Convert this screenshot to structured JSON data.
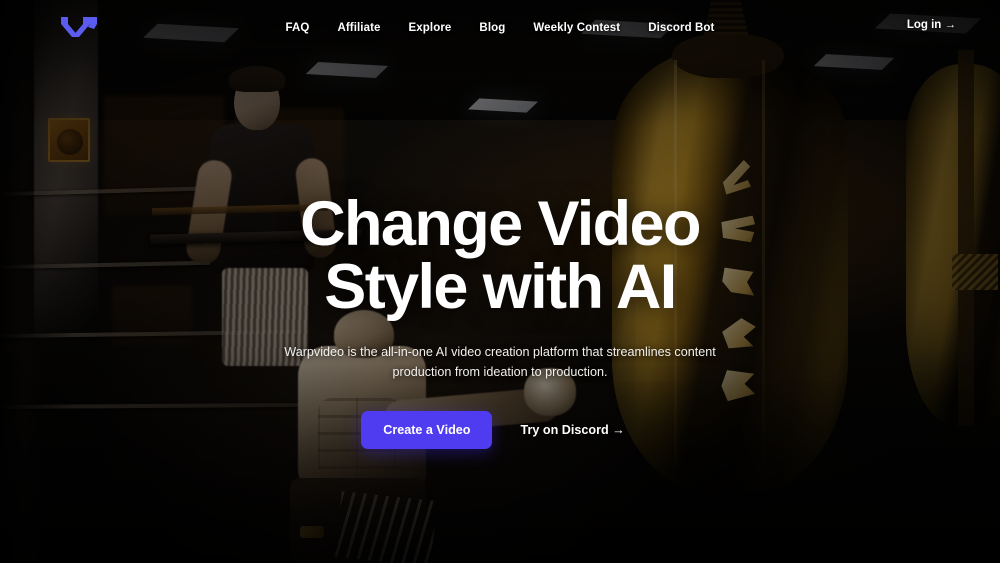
{
  "site": {
    "brand_name": "Warpvideo",
    "logo_icon": "warp-w-logo-icon",
    "accent_color": "#4f3cf0",
    "logo_color": "#5b5bf0"
  },
  "header": {
    "nav_items": [
      {
        "label": "FAQ"
      },
      {
        "label": "Affiliate"
      },
      {
        "label": "Explore"
      },
      {
        "label": "Blog"
      },
      {
        "label": "Weekly Contest"
      },
      {
        "label": "Discord Bot"
      }
    ],
    "login_label": "Log in →"
  },
  "hero": {
    "heading_line1": "Change Video",
    "heading_line2": "Style with AI",
    "subheading": "Warpvideo is the all-in-one AI video creation platform that streamlines content production from ideation to production.",
    "primary_cta": "Create a Video",
    "secondary_cta": "Try on Discord →"
  },
  "background": {
    "description": "Dark gym interior with boxing ring, ceiling light panels, a standing figure at left, a kneeling muscular figure center, and large golden punching bags at right"
  }
}
